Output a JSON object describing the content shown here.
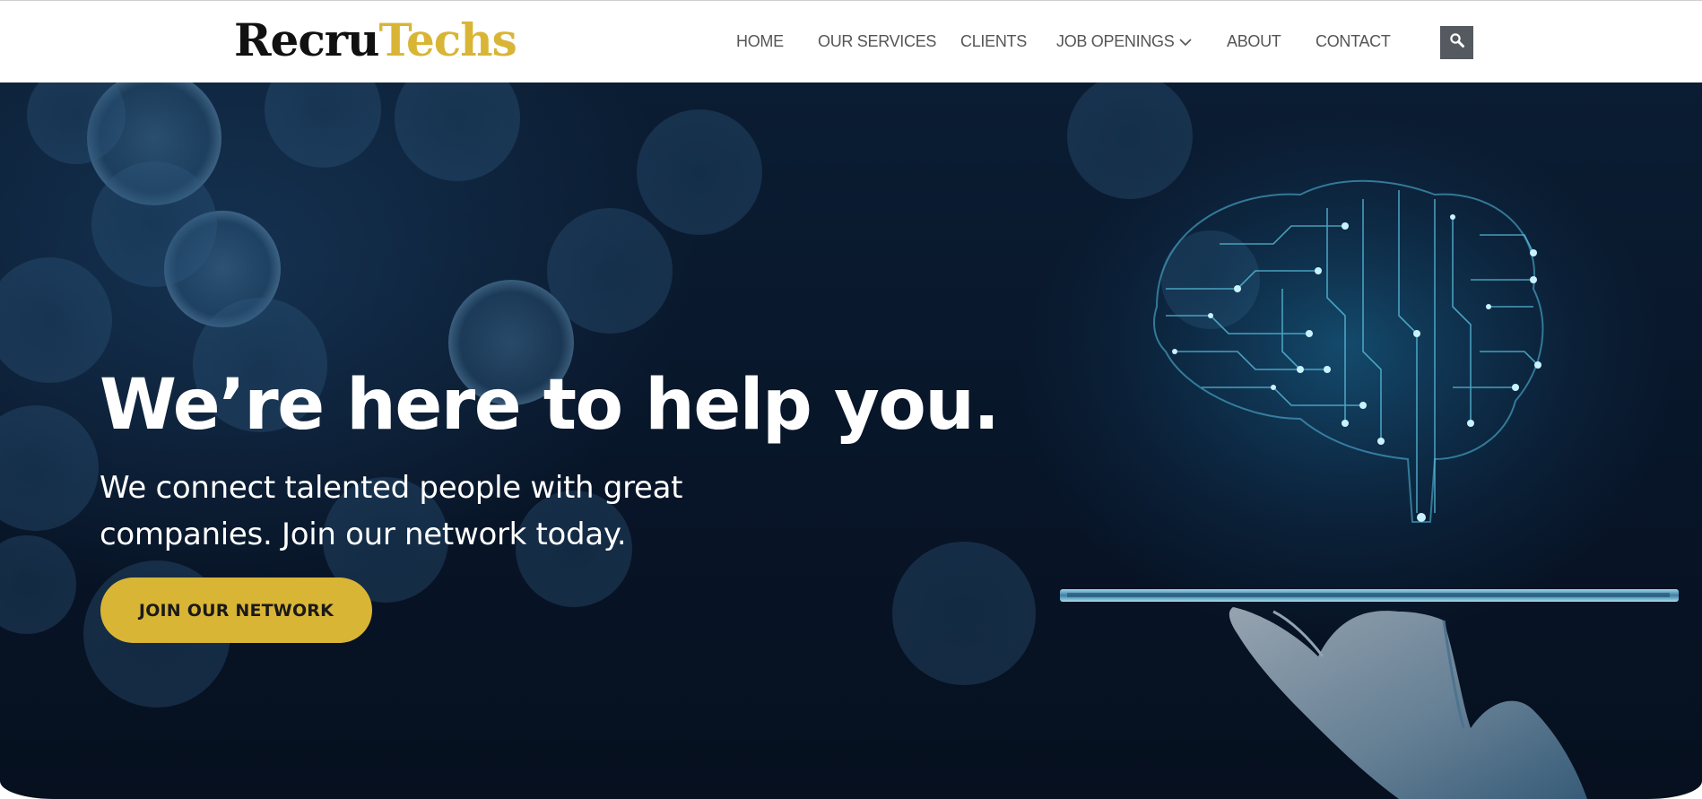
{
  "brand": {
    "name_part1": "Recru",
    "name_part2": "Techs"
  },
  "nav": {
    "items": [
      {
        "label": "HOME"
      },
      {
        "label": "OUR SERVICES"
      },
      {
        "label": "CLIENTS"
      },
      {
        "label": "JOB OPENINGS",
        "has_dropdown": true
      },
      {
        "label": "ABOUT"
      },
      {
        "label": "CONTACT"
      }
    ],
    "search_icon": "search-icon"
  },
  "hero": {
    "title": "We’re here to help you.",
    "subtitle_line1": "We connect talented people with great",
    "subtitle_line2": "companies. Join our network today.",
    "cta_label": "JOIN OUR NETWORK"
  },
  "colors": {
    "accent": "#d9b536",
    "nav_text": "#555555",
    "hero_bg": "#0b1d33",
    "search_bg": "#555a60"
  }
}
